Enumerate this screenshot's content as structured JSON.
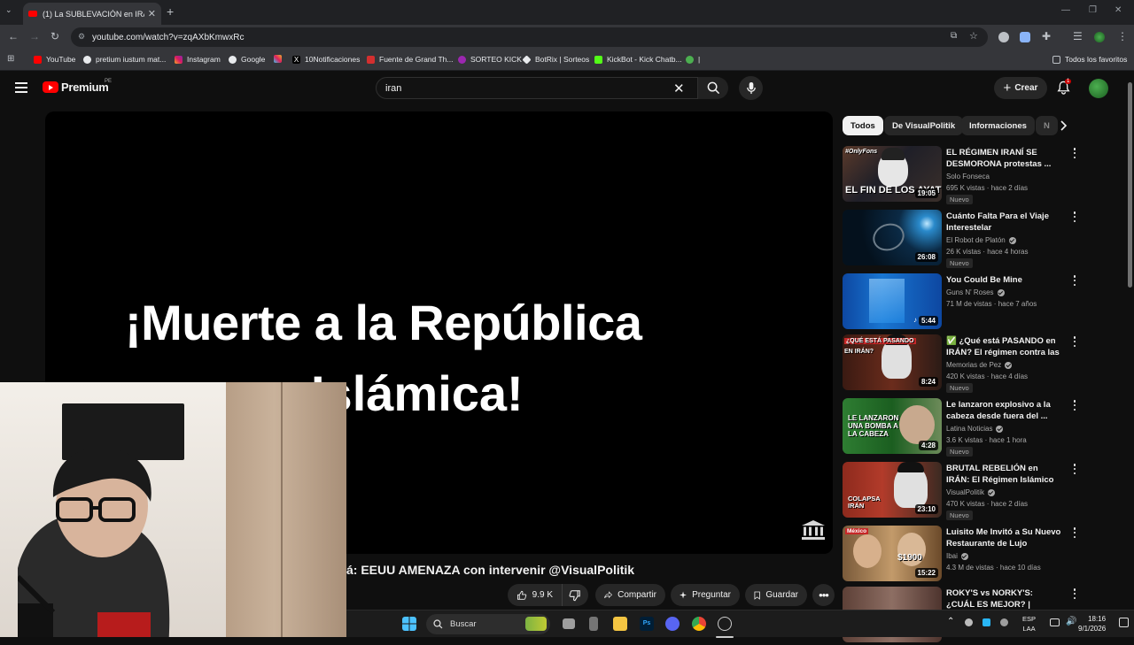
{
  "browser": {
    "tab_title": "(1) La SUBLEVACIÓN en IRÁN s",
    "url": "youtube.com/watch?v=zqAXbKmwxRc",
    "bookmarks": [
      "YouTube",
      "pretium iustum mat...",
      "Instagram",
      "Google",
      "10Notificaciones",
      "Fuente de Grand Th...",
      "SORTEO KICK",
      "BotRix | Sorteos",
      "KickBot - Kick Chatb...",
      "|"
    ],
    "all_bookmarks": "Todos los favoritos"
  },
  "youtube": {
    "logo": "Premium",
    "region": "PE",
    "search_value": "iran",
    "create_label": "Crear",
    "notif_count": "1"
  },
  "player": {
    "caption_line1": "¡Muerte a la República",
    "caption_line2": "Islámica!"
  },
  "video": {
    "title_visible": "á: EEUU AMENAZA con intervenir @VisualPolitik",
    "likes": "9.9 K",
    "share": "Compartir",
    "ask": "Preguntar",
    "save": "Guardar"
  },
  "chips": [
    "Todos",
    "De VisualPolitik",
    "Informaciones",
    "N"
  ],
  "recommendations": [
    {
      "title": "EL RÉGIMEN IRANÍ SE DESMORONA protestas ...",
      "channel": "Solo Fonseca",
      "verified": false,
      "meta": "695 K vistas · hace 2 días",
      "badge": "Nuevo",
      "duration": "19:05",
      "thumb_text": "EL FIN DE LOS AYAT",
      "thumb_tag": "#OnlyFons"
    },
    {
      "title": "Cuánto Falta Para el Viaje Interestelar",
      "channel": "El Robot de Platón",
      "verified": true,
      "meta": "26 K vistas · hace 4 horas",
      "badge": "Nuevo",
      "duration": "26:08",
      "thumb_text": "",
      "thumb_tag": ""
    },
    {
      "title": "You Could Be Mine",
      "channel": "Guns N' Roses",
      "verified": true,
      "meta": "71 M de vistas · hace 7 años",
      "badge": "",
      "duration": "5:44",
      "thumb_text": "",
      "thumb_tag": ""
    },
    {
      "title": "✅ ¿Qué está PASANDO en IRÁN? El régimen contra las ...",
      "channel": "Memorias de Pez",
      "verified": true,
      "meta": "420 K vistas · hace 4 días",
      "badge": "Nuevo",
      "duration": "8:24",
      "thumb_text": "EN IRÁN?",
      "thumb_tag": "¿QUÉ ESTÁ PASANDO"
    },
    {
      "title": "Le lanzaron explosivo a la cabeza desde fuera del ...",
      "channel": "Latina Noticias",
      "verified": true,
      "meta": "3.6 K vistas · hace 1 hora",
      "badge": "Nuevo",
      "duration": "4:28",
      "thumb_text": "LE LANZARON UNA BOMBA A LA CABEZA",
      "thumb_tag": ""
    },
    {
      "title": "BRUTAL REBELIÓN en IRÁN: El Régimen Islámico en Estado ...",
      "channel": "VisualPolitik",
      "verified": true,
      "meta": "470 K vistas · hace 2 días",
      "badge": "Nuevo",
      "duration": "23:10",
      "thumb_text": "COLAPSA IRÁN",
      "thumb_tag": ""
    },
    {
      "title": "Luisito Me Invitó a Su Nuevo Restaurante de Lujo",
      "channel": "Ibai",
      "verified": true,
      "meta": "4.3 M de vistas · hace 10 días",
      "badge": "",
      "duration": "15:22",
      "thumb_text": "$1900",
      "thumb_tag": "México"
    },
    {
      "title": "ROKY'S vs NORKY'S: ¿CUÁL ES MEJOR? | GIACOMO BOCCHIO",
      "channel": "",
      "verified": false,
      "meta": "",
      "badge": "",
      "duration": "",
      "thumb_text": "",
      "thumb_tag": ""
    }
  ],
  "taskbar": {
    "search_placeholder": "Buscar",
    "lang_top": "ESP",
    "lang_bottom": "LAA",
    "time": "18:16",
    "date": "9/1/2026"
  }
}
